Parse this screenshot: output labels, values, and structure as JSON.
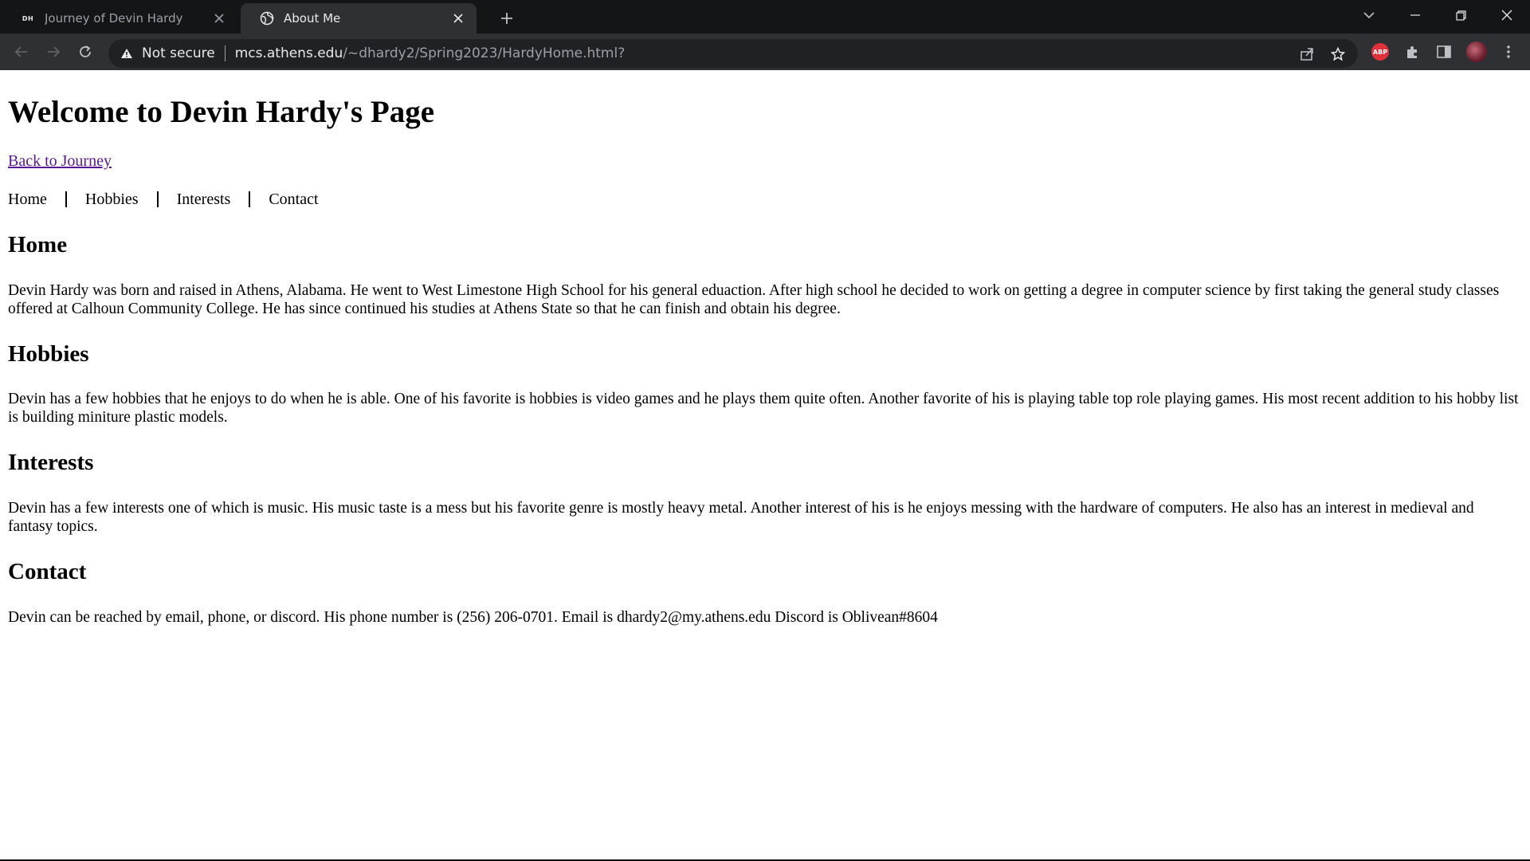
{
  "browser": {
    "tabs": [
      {
        "label": "Journey of Devin Hardy",
        "favicon_text": "DH",
        "active": false
      },
      {
        "label": "About Me",
        "active": true
      }
    ],
    "address": {
      "security_label": "Not secure",
      "url_host": "mcs.athens.edu",
      "url_path": "/~dhardy2/Spring2023/HardyHome.html?"
    },
    "extensions": {
      "abp_label": "ABP"
    },
    "colors": {
      "frame": "#202124",
      "tabstrip": "#141517",
      "active_tab": "#2f3033",
      "abp": "#e0303a"
    }
  },
  "page": {
    "title": "Welcome to Devin Hardy's Page",
    "back_link": "Back to Journey",
    "nav": [
      "Home",
      "Hobbies",
      "Interests",
      "Contact"
    ],
    "sections": [
      {
        "heading": "Home",
        "text": "Devin Hardy was born and raised in Athens, Alabama. He went to West Limestone High School for his general eduaction. After high school he decided to work on getting a degree in computer science by first taking the general study classes offered at Calhoun Community College. He has since continued his studies at Athens State so that he can finish and obtain his degree."
      },
      {
        "heading": "Hobbies",
        "text": "Devin has a few hobbies that he enjoys to do when he is able. One of his favorite is hobbies is video games and he plays them quite often. Another favorite of his is playing table top role playing games. His most recent addition to his hobby list is building miniture plastic models."
      },
      {
        "heading": "Interests",
        "text": "Devin has a few interests one of which is music. His music taste is a mess but his favorite genre is mostly heavy metal. Another interest of his is he enjoys messing with the hardware of computers. He also has an interest in medieval and fantasy topics."
      },
      {
        "heading": "Contact",
        "text": "Devin can be reached by email, phone, or discord. His phone number is (256) 206-0701. Email is dhardy2@my.athens.edu Discord is Oblivean#8604"
      }
    ]
  }
}
